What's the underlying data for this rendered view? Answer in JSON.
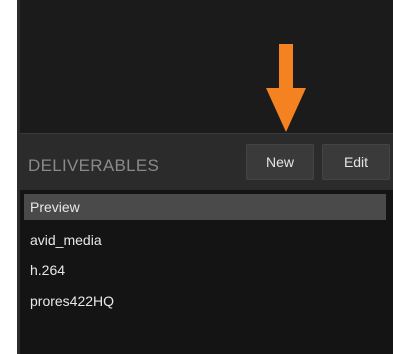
{
  "deliverables": {
    "title": "DELIVERABLES",
    "new_label": "New",
    "edit_label": "Edit",
    "items": [
      {
        "label": "Preview",
        "selected": true
      },
      {
        "label": "avid_media",
        "selected": false
      },
      {
        "label": "h.264",
        "selected": false
      },
      {
        "label": "prores422HQ",
        "selected": false
      }
    ]
  },
  "annotation": {
    "icon": "arrow-down-icon",
    "color": "#f58220"
  },
  "colors": {
    "panel_bg": "#2b2b2b",
    "list_bg": "#141414",
    "selected_bg": "#4a4a4a",
    "title_text": "#8a8a8a"
  }
}
